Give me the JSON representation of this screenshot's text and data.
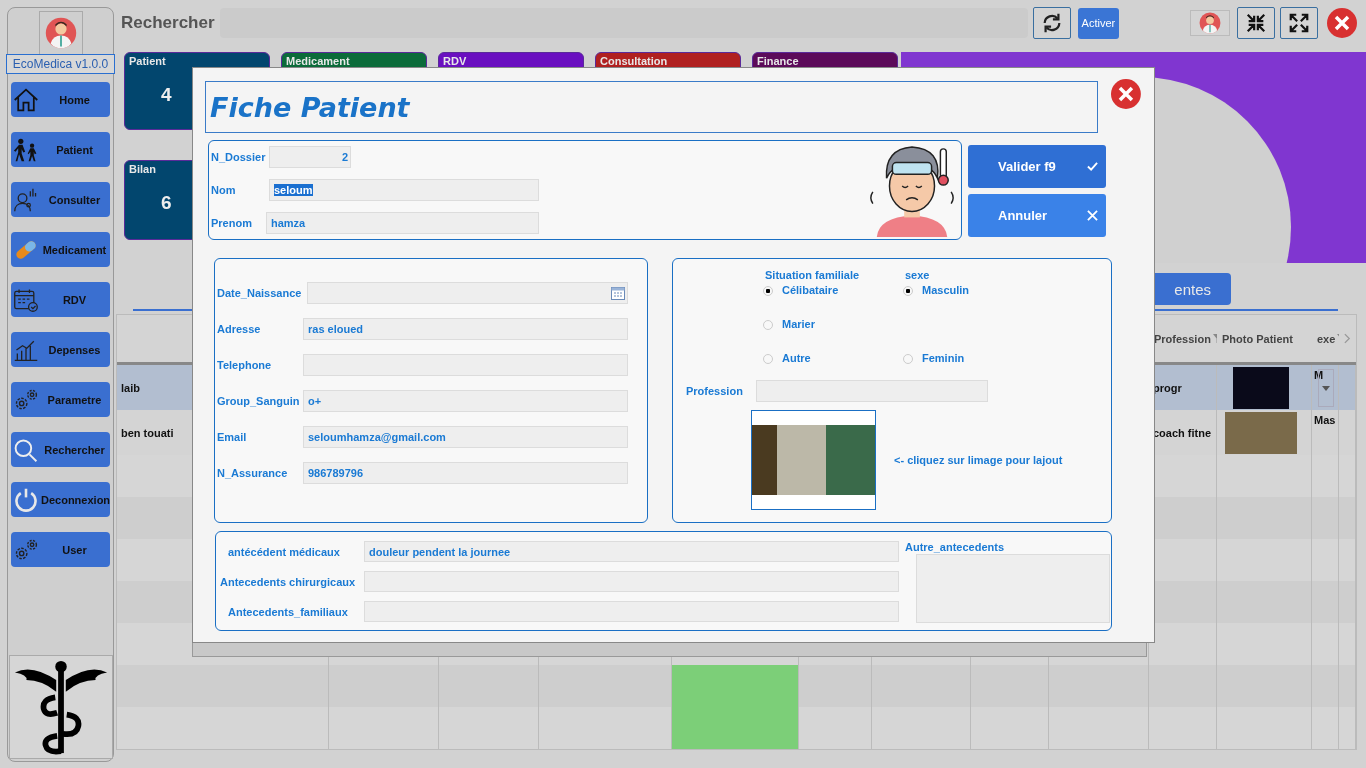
{
  "sidebar": {
    "version": "EcoMedica v1.0.0",
    "items": [
      {
        "label": "Home",
        "kind": "home"
      },
      {
        "label": "Patient",
        "kind": "people"
      },
      {
        "label": "Consulter",
        "kind": "doctor"
      },
      {
        "label": "Medicament",
        "kind": "pill"
      },
      {
        "label": "RDV",
        "kind": "calendar"
      },
      {
        "label": "Depenses",
        "kind": "chart"
      },
      {
        "label": "Parametre",
        "kind": "gears"
      },
      {
        "label": "Rechercher",
        "kind": "search"
      },
      {
        "label": "Deconnexion",
        "kind": "power"
      },
      {
        "label": "User",
        "kind": "gears"
      }
    ]
  },
  "topbar": {
    "title": "Rechercher",
    "activate_button": "Activer"
  },
  "tiles": [
    {
      "label": "Patient",
      "value": "4",
      "color": "#02466e"
    },
    {
      "label": "Medicament",
      "color": "#0b6b3a"
    },
    {
      "label": "RDV",
      "color": "#6a0fc0"
    },
    {
      "label": "Consultation",
      "color": "#b02020"
    },
    {
      "label": "Finance",
      "color": "#5c0a5a"
    },
    {
      "label": "Bilan",
      "value": "6",
      "color": "#02466e"
    }
  ],
  "tab_button": "entes",
  "table": {
    "columns": [
      {
        "label": "Profession",
        "filter": true
      },
      {
        "label": "Photo Patient",
        "filter": false
      },
      {
        "label": "exe",
        "filter": true
      }
    ],
    "rows": [
      {
        "name": "laib",
        "profession": "progr",
        "sexe": "M",
        "dropdown": true,
        "selected": true
      },
      {
        "name": "ben touati",
        "profession": "coach fitne",
        "sexe": "Mas",
        "dropdown": false,
        "selected": false
      }
    ]
  },
  "modal": {
    "title": "Fiche Patient",
    "dossier": {
      "label": "N_Dossier",
      "value": "2"
    },
    "nom": {
      "label": "Nom",
      "value": "seloum",
      "selected": true
    },
    "prenom": {
      "label": "Prenom",
      "value": "hamza"
    },
    "buttons": [
      {
        "label": "Valider f9",
        "kind": "validate"
      },
      {
        "label": "Annuler",
        "kind": "cancel"
      }
    ],
    "fields": [
      {
        "label": "Date_Naissance",
        "kind": "date"
      },
      {
        "label": "Adresse",
        "value": "ras eloued",
        "kind": "text"
      },
      {
        "label": "Telephone",
        "kind": "text"
      },
      {
        "label": "Group_Sanguin",
        "value": "o+",
        "kind": "text"
      },
      {
        "label": "Email",
        "value": "seloumhamza@gmail.com",
        "kind": "text"
      },
      {
        "label": "N_Assurance",
        "value": "986789796",
        "kind": "text"
      }
    ],
    "radio_groups": [
      {
        "label": "Situation familiale",
        "options": [
          {
            "label": "Célibataire",
            "selected": true
          },
          {
            "label": "Marier",
            "selected": false
          },
          {
            "label": "Autre",
            "selected": false
          }
        ]
      },
      {
        "label": "sexe",
        "options": [
          {
            "label": "Masculin",
            "selected": true
          },
          {
            "label": "Feminin",
            "selected": false
          }
        ]
      }
    ],
    "profession": {
      "label": "Profession"
    },
    "photo_hint": "<- cliquez sur limage pour lajout",
    "antecedents": [
      {
        "label": "antécédent médicaux",
        "value": "douleur pendent la journee"
      },
      {
        "label": "Antecedents chirurgicaux"
      },
      {
        "label": "Antecedents_familiaux"
      }
    ],
    "autre": {
      "label": "Autre_antecedents"
    }
  }
}
